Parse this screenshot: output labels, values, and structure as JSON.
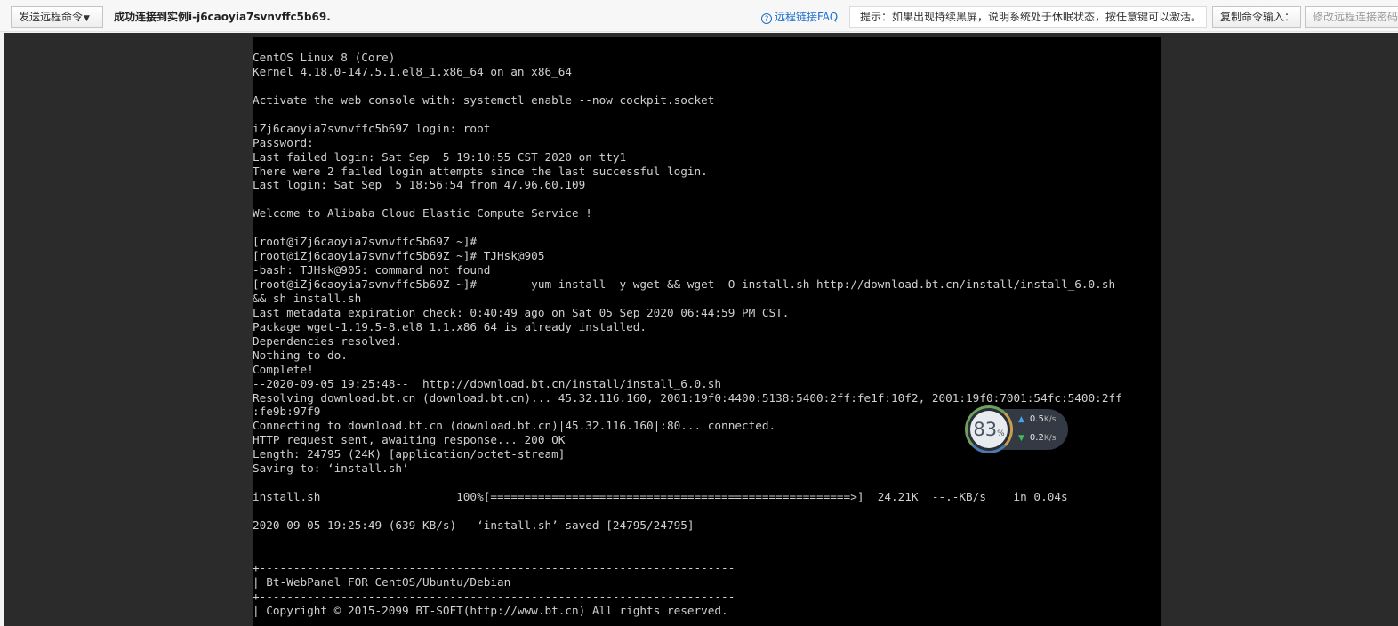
{
  "toolbar": {
    "send_command_label": "发送远程命令",
    "status_text": "成功连接到实例i-j6caoyia7svnvffc5b69.",
    "faq_label": "远程链接FAQ",
    "hint_text": "提示：如果出现持续黑屏，说明系统处于休眠状态，按任意键可以激活。",
    "copy_command_label": "复制命令输入：",
    "modify_password_label": "修改远程连接密码"
  },
  "terminal": {
    "lines": [
      "CentOS Linux 8 (Core)",
      "Kernel 4.18.0-147.5.1.el8_1.x86_64 on an x86_64",
      "",
      "Activate the web console with: systemctl enable --now cockpit.socket",
      "",
      "iZj6caoyia7svnvffc5b69Z login: root",
      "Password:",
      "Last failed login: Sat Sep  5 19:10:55 CST 2020 on tty1",
      "There were 2 failed login attempts since the last successful login.",
      "Last login: Sat Sep  5 18:56:54 from 47.96.60.109",
      "",
      "Welcome to Alibaba Cloud Elastic Compute Service !",
      "",
      "[root@iZj6caoyia7svnvffc5b69Z ~]#",
      "[root@iZj6caoyia7svnvffc5b69Z ~]# TJHsk@905",
      "-bash: TJHsk@905: command not found",
      "[root@iZj6caoyia7svnvffc5b69Z ~]#        yum install -y wget && wget -O install.sh http://download.bt.cn/install/install_6.0.sh",
      "&& sh install.sh",
      "Last metadata expiration check: 0:40:49 ago on Sat 05 Sep 2020 06:44:59 PM CST.",
      "Package wget-1.19.5-8.el8_1.1.x86_64 is already installed.",
      "Dependencies resolved.",
      "Nothing to do.",
      "Complete!",
      "--2020-09-05 19:25:48--  http://download.bt.cn/install/install_6.0.sh",
      "Resolving download.bt.cn (download.bt.cn)... 45.32.116.160, 2001:19f0:4400:5138:5400:2ff:fe1f:10f2, 2001:19f0:7001:54fc:5400:2ff",
      ":fe9b:97f9",
      "Connecting to download.bt.cn (download.bt.cn)|45.32.116.160|:80... connected.",
      "HTTP request sent, awaiting response... 200 OK",
      "Length: 24795 (24K) [application/octet-stream]",
      "Saving to: ‘install.sh’",
      "",
      "install.sh                    100%[=====================================================>]  24.21K  --.-KB/s    in 0.04s",
      "",
      "2020-09-05 19:25:49 (639 KB/s) - ‘install.sh’ saved [24795/24795]",
      "",
      "",
      "+----------------------------------------------------------------------",
      "| Bt-WebPanel FOR CentOS/Ubuntu/Debian",
      "+----------------------------------------------------------------------",
      "| Copyright © 2015-2099 BT-SOFT(http://www.bt.cn) All rights reserved."
    ]
  },
  "speed_widget": {
    "percent": "83",
    "percent_sign": "%",
    "upload_value": "0.5",
    "download_value": "0.2",
    "unit": "K/s"
  },
  "colors": {
    "terminal_bg": "#000000",
    "terminal_fg": "#d0d0d0",
    "stage_bg": "#2b2b2b",
    "link_blue": "#1f6fcc"
  }
}
